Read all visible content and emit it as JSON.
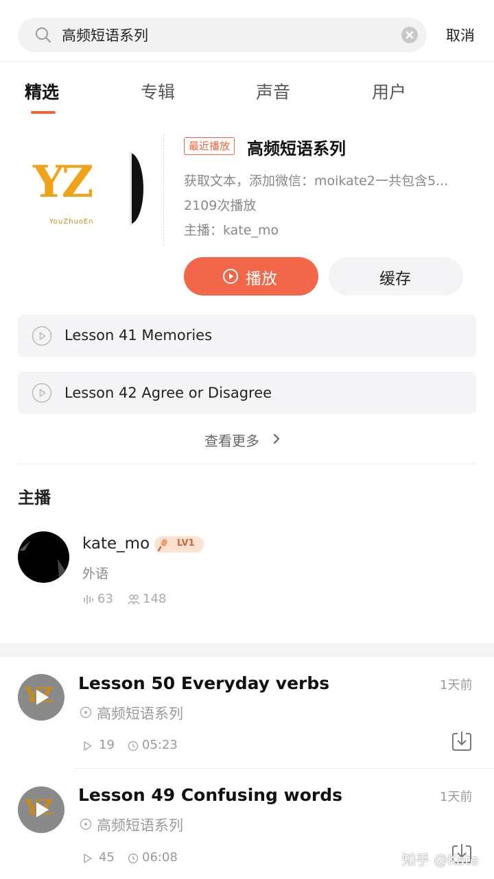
{
  "search": {
    "query": "高频短语系列",
    "cancel_label": "取消"
  },
  "tabs": [
    {
      "label": "精选",
      "active": true
    },
    {
      "label": "专辑",
      "active": false
    },
    {
      "label": "声音",
      "active": false
    },
    {
      "label": "用户",
      "active": false
    }
  ],
  "album": {
    "cover_text": "YZ",
    "cover_subtext": "YouZhuoEn",
    "badge": "最近播放",
    "title": "高频短语系列",
    "description": "获取文本，添加微信：moikate2一共包含5...",
    "plays": "2109次播放",
    "host": "主播：kate_mo",
    "play_label": "播放",
    "cache_label": "缓存"
  },
  "lessons": [
    {
      "title": "Lesson 41 Memories"
    },
    {
      "title": "Lesson 42 Agree or Disagree"
    }
  ],
  "more_label": "查看更多",
  "host_section": {
    "heading": "主播",
    "name": "kate_mo",
    "level": "LV1",
    "category": "外语",
    "tracks_count": "63",
    "followers_count": "148"
  },
  "tracks": [
    {
      "title": "Lesson 50 Everyday verbs",
      "time": "1天前",
      "album": "高频短语系列",
      "plays": "19",
      "duration": "05:23"
    },
    {
      "title": "Lesson 49 Confusing words",
      "time": "1天前",
      "album": "高频短语系列",
      "plays": "45",
      "duration": "06:08"
    }
  ],
  "watermark": "知乎 @Kate",
  "colors": {
    "accent": "#f2664a",
    "badge_bg": "#fde2d2",
    "cover_yellow": "#f0a318"
  },
  "icons": [
    "search-icon",
    "clear-icon",
    "play-circle-icon",
    "chevron-right-icon",
    "microphone-icon",
    "waveform-icon",
    "followers-icon",
    "play-triangle-icon",
    "clock-icon",
    "album-icon",
    "download-icon"
  ]
}
